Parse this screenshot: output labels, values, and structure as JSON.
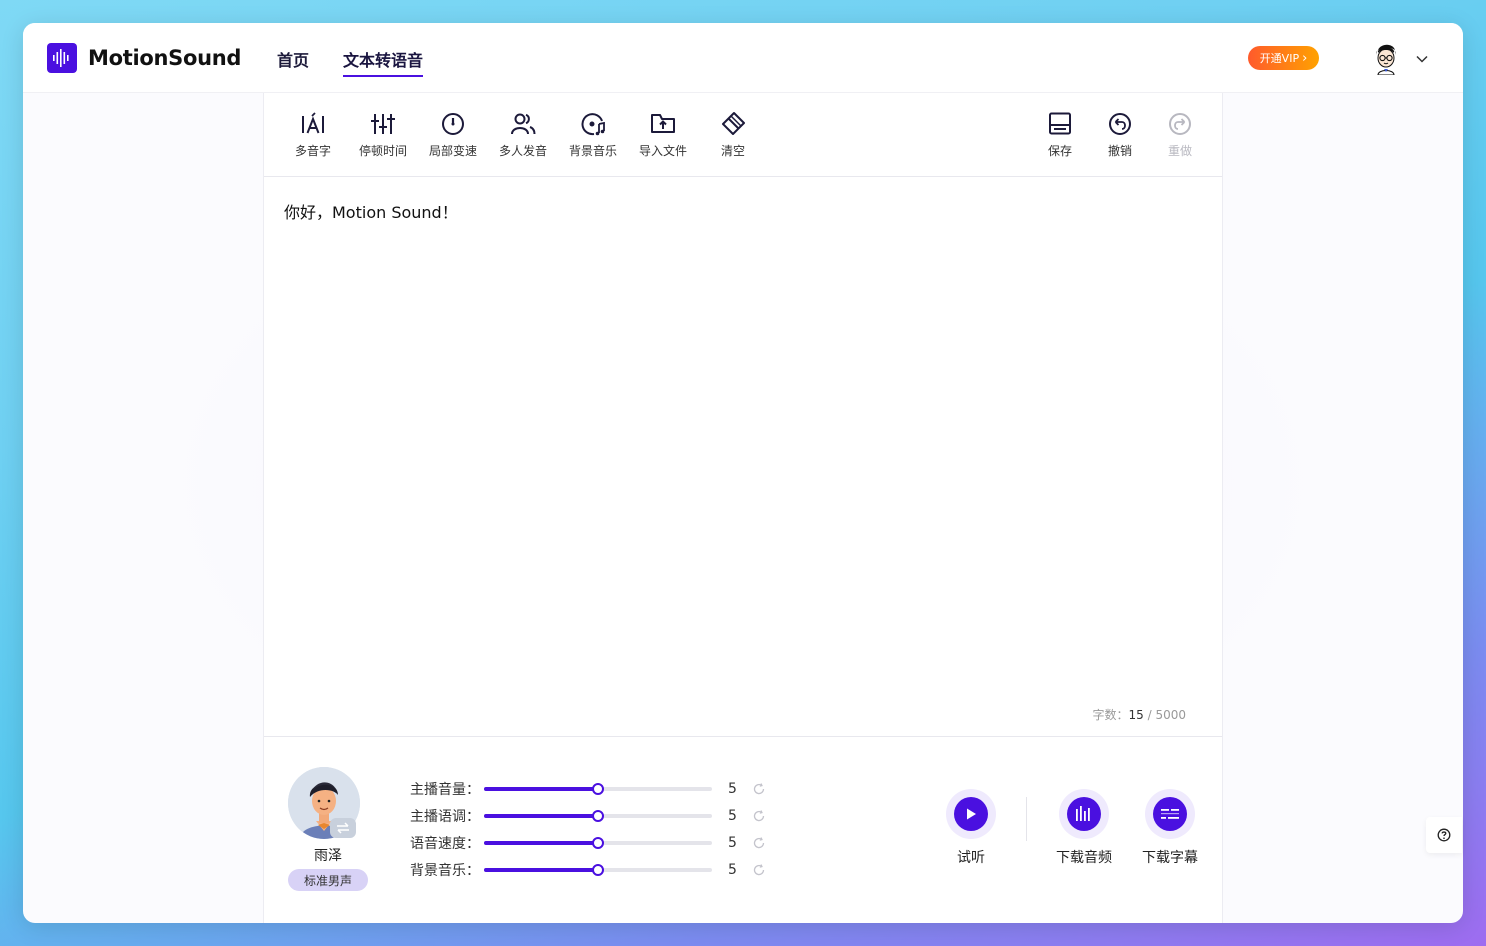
{
  "header": {
    "logo_text": "MotionSound",
    "nav": [
      {
        "label": "首页",
        "active": false
      },
      {
        "label": "文本转语音",
        "active": true
      }
    ],
    "vip_label": "开通VIP",
    "vip_chevron": "›"
  },
  "toolbar": {
    "left_tools": [
      {
        "label": "多音字",
        "icon": "polyphone-icon"
      },
      {
        "label": "停顿时间",
        "icon": "pause-sliders-icon"
      },
      {
        "label": "局部变速",
        "icon": "speed-dial-icon"
      },
      {
        "label": "多人发音",
        "icon": "multi-speaker-icon"
      },
      {
        "label": "背景音乐",
        "icon": "music-disc-icon"
      },
      {
        "label": "导入文件",
        "icon": "import-folder-icon"
      },
      {
        "label": "清空",
        "icon": "eraser-icon"
      }
    ],
    "right_tools": [
      {
        "label": "保存",
        "icon": "save-icon",
        "enabled": true
      },
      {
        "label": "撤销",
        "icon": "undo-icon",
        "enabled": true
      },
      {
        "label": "重做",
        "icon": "redo-icon",
        "enabled": false
      }
    ]
  },
  "editor": {
    "text": "你好，Motion Sound！",
    "count_label": "字数：",
    "count_current": "15",
    "count_sep": " / ",
    "count_max": "5000"
  },
  "voice": {
    "name": "雨泽",
    "tag": "标准男声"
  },
  "sliders": [
    {
      "label": "主播音量：",
      "value": 5,
      "max": 10
    },
    {
      "label": "主播语调：",
      "value": 5,
      "max": 10
    },
    {
      "label": "语音速度：",
      "value": 5,
      "max": 10
    },
    {
      "label": "背景音乐：",
      "value": 5,
      "max": 10
    }
  ],
  "actions": {
    "preview": "试听",
    "download_audio": "下载音频",
    "download_subtitle": "下载字幕"
  },
  "colors": {
    "brand": "#4a10e0",
    "vip_start": "#ff5a2c",
    "vip_end": "#ffa200"
  }
}
